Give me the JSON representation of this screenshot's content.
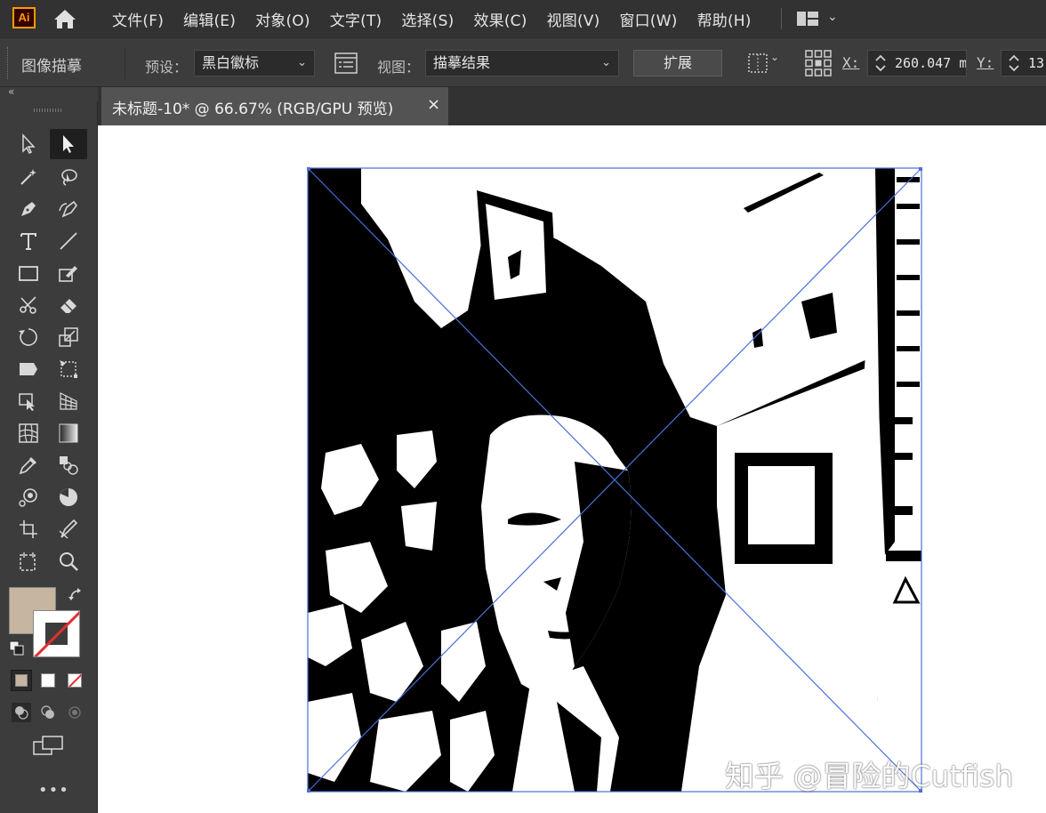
{
  "app": {
    "logo_text": "Ai"
  },
  "menu": {
    "items": [
      "文件(F)",
      "编辑(E)",
      "对象(O)",
      "文字(T)",
      "选择(S)",
      "效果(C)",
      "视图(V)",
      "窗口(W)",
      "帮助(H)"
    ]
  },
  "control_bar": {
    "panel_title": "图像描摹",
    "preset_label": "预设：",
    "preset_value": "黑白徽标",
    "view_label": "视图：",
    "view_value": "描摹结果",
    "expand_button": "扩展",
    "x_label": "X:",
    "x_value": "260.047 m",
    "y_label": "Y:",
    "y_value": "13"
  },
  "document": {
    "tab_title": "未标题-10* @ 66.67% (RGB/GPU 预览)",
    "tab_close": "×"
  },
  "colors": {
    "fill": "#c6b59f",
    "stroke": "#ffffff",
    "bbox": "#4a6fd8",
    "app_accent": "#ff9a00"
  },
  "watermark": "知乎 @冒险的Cutfish",
  "toolbar": {
    "more": "•••"
  }
}
